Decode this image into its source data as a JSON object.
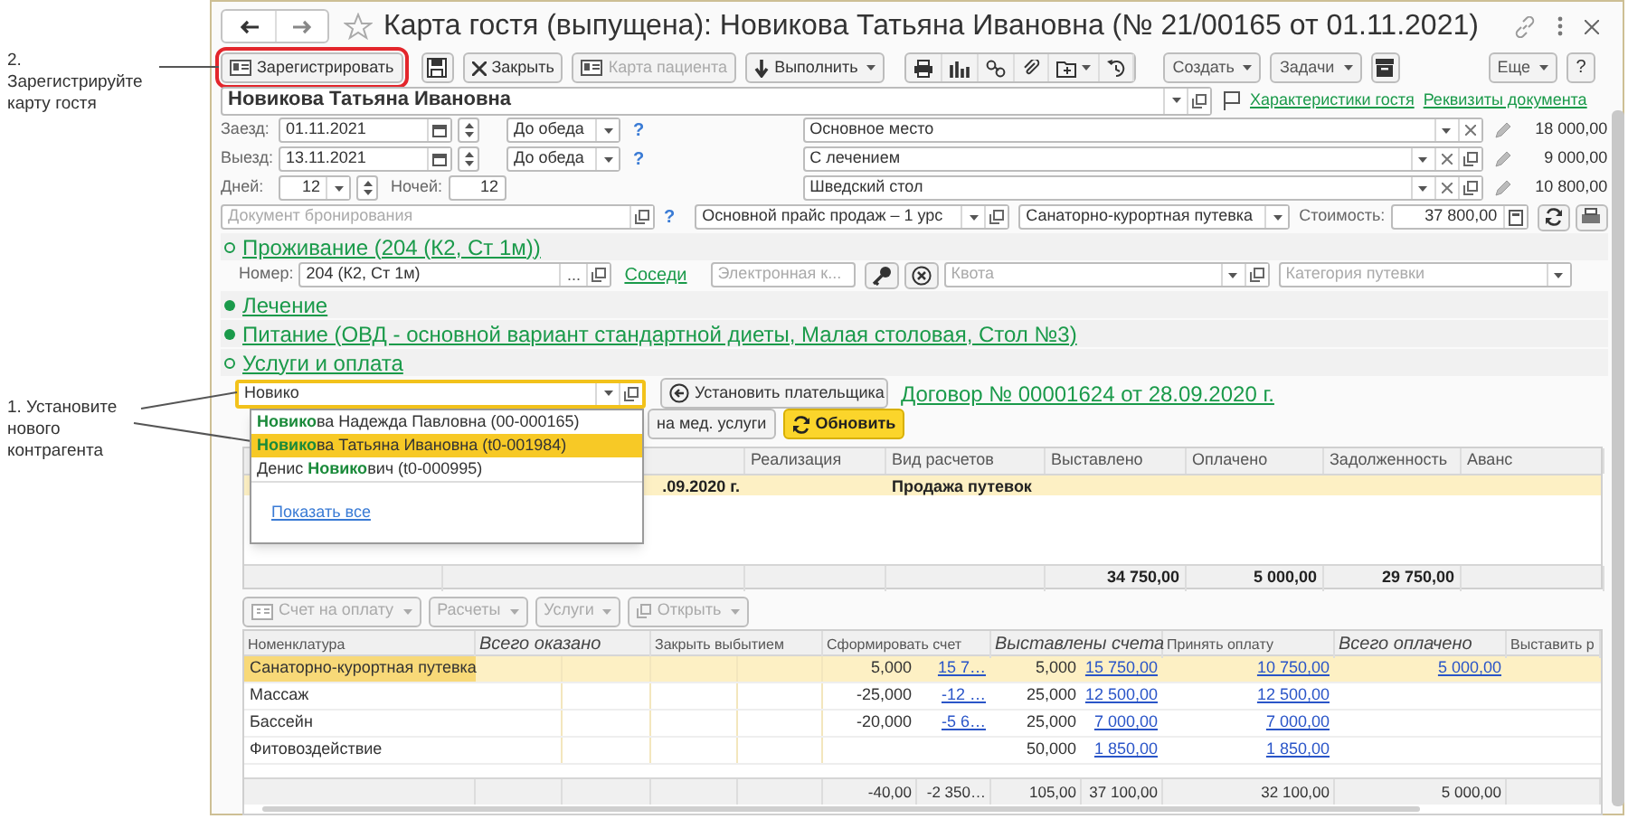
{
  "annotations": [
    {
      "text": "2. Зарегистрируйте карту гостя"
    },
    {
      "text": "1. Установите нового контрагента"
    }
  ],
  "window": {
    "title": "Карта гостя (выпущена): Новикова Татьяна Ивановна (№ 21/00165 от 01.11.2021)"
  },
  "toolbar": {
    "buttons": [
      {
        "label": "Зарегистрировать",
        "highlighted": true,
        "disabled": false,
        "menu": false
      },
      {
        "label": "Закрыть",
        "highlighted": false,
        "disabled": false,
        "menu": false
      },
      {
        "label": "Карта пациента",
        "highlighted": false,
        "disabled": true,
        "menu": false
      },
      {
        "label": "Выполнить",
        "highlighted": false,
        "disabled": false,
        "menu": true
      }
    ],
    "menus": [
      "Создать",
      "Задачи"
    ],
    "more": "Еще",
    "help": "?"
  },
  "guest_name": "Новикова Татьяна Ивановна",
  "links": [
    "Характеристики гостя",
    "Реквизиты документа"
  ],
  "stay": [
    {
      "label": "Заезд:",
      "date": "01.11.2021",
      "time": "До обеда",
      "help": "?"
    },
    {
      "label": "Выезд:",
      "date": "13.11.2021",
      "time": "До обеда",
      "help": "?"
    }
  ],
  "days": {
    "label": "Дней:",
    "value": "12"
  },
  "nights": {
    "label": "Ночей:",
    "value": "12"
  },
  "services": [
    {
      "value": "Основное место",
      "price": "18 000,00",
      "openable": false
    },
    {
      "value": "С лечением",
      "price": "9 000,00",
      "openable": true
    },
    {
      "value": "Шведский стол",
      "price": "10 800,00",
      "openable": true
    }
  ],
  "booking_document": {
    "placeholder": "Документ бронирования",
    "help": "?"
  },
  "price_list": "Основной прайс продаж – 1 урс",
  "voucher_type": "Санаторно-курортная путевка",
  "cost": {
    "label": "Стоимость:",
    "value": "37 800,00"
  },
  "sections": [
    {
      "title": "Проживание (204 (К2, Ст 1м))",
      "expanded": true
    },
    {
      "title": "Лечение",
      "expanded": false
    },
    {
      "title": "Питание (ОВД - основной вариант стандартной диеты, Малая столовая, Стол №3)",
      "expanded": false
    },
    {
      "title": "Услуги и оплата",
      "expanded": true
    }
  ],
  "room": {
    "label": "Номер:",
    "value": "204 (К2, Ст 1м)",
    "choose": "...",
    "neighbors": "Соседи",
    "card_placeholder": "Электронная к...",
    "quota_placeholder": "Квота",
    "category_placeholder": "Категория путевки"
  },
  "payer": {
    "value": "Новико",
    "set_button": "Установить плательщика",
    "contract": "Договор № 00001624 от 28.09.2020 г."
  },
  "payment_buttons": [
    {
      "label": "на мед. услуги",
      "primary": false
    },
    {
      "label": "Обновить",
      "primary": true
    }
  ],
  "suggestions": {
    "items": [
      {
        "text": "**Новико**ва Надежда Павловна (00-000165)",
        "selected": false
      },
      {
        "text": "**Новико**ва Татьяна Ивановна (t0-001984)",
        "selected": true
      },
      {
        "text": "Денис **Новико**вич (t0-000995)",
        "selected": false
      }
    ],
    "show_all": "Показать все"
  },
  "settlements": {
    "columns": [
      "Реализация",
      "Вид расчетов",
      "Выставлено",
      "Оплачено",
      "Задолженность",
      "Аванс"
    ],
    "rows": [
      {
        "column_2": ".09.2020 г.",
        "settlement_type": "Продажа путевок",
        "selected": true
      }
    ],
    "totals": {
      "issued": "34 750,00",
      "paid": "5 000,00",
      "debt": "29 750,00"
    }
  },
  "services_toolbar": [
    "Счет на оплату",
    "Расчеты",
    "Услуги",
    "Открыть"
  ],
  "services_table": {
    "columns": [
      {
        "label": "Номенклатура",
        "italic": false
      },
      {
        "label": "Всего оказано",
        "italic": true
      },
      {
        "label": "Закрыть выбытием",
        "italic": false
      },
      {
        "label": "Сформировать счет",
        "italic": false
      },
      {
        "label": "Выставлены счета",
        "italic": true
      },
      {
        "label": "Принять оплату",
        "italic": false
      },
      {
        "label": "Всего оплачено",
        "italic": true
      },
      {
        "label": "Выставить р",
        "italic": false
      }
    ],
    "rows": [
      {
        "name": "Санаторно-курортная путевка",
        "invoice_qty": "5,000",
        "invoice_sum": "15 7…",
        "issued_qty": "5,000",
        "issued_sum": "15 750,00",
        "accept": "10 750,00",
        "paid": "5 000,00",
        "selected": true
      },
      {
        "name": "Массаж",
        "invoice_qty": "-25,000",
        "invoice_sum": "-12 …",
        "issued_qty": "25,000",
        "issued_sum": "12 500,00",
        "accept": "12 500,00",
        "selected": false
      },
      {
        "name": "Бассейн",
        "invoice_qty": "-20,000",
        "invoice_sum": "-5 6…",
        "issued_qty": "25,000",
        "issued_sum": "7 000,00",
        "accept": "7 000,00",
        "selected": false
      },
      {
        "name": "Фитовоздействие",
        "issued_qty": "50,000",
        "issued_sum": "1 850,00",
        "accept": "1 850,00",
        "selected": false
      }
    ],
    "totals": {
      "invoice_qty": "-40,00",
      "invoice_sum": "-2 350…",
      "issued_qty": "105,00",
      "issued_sum": "37 100,00",
      "accept": "32 100,00",
      "paid": "5 000,00"
    }
  }
}
